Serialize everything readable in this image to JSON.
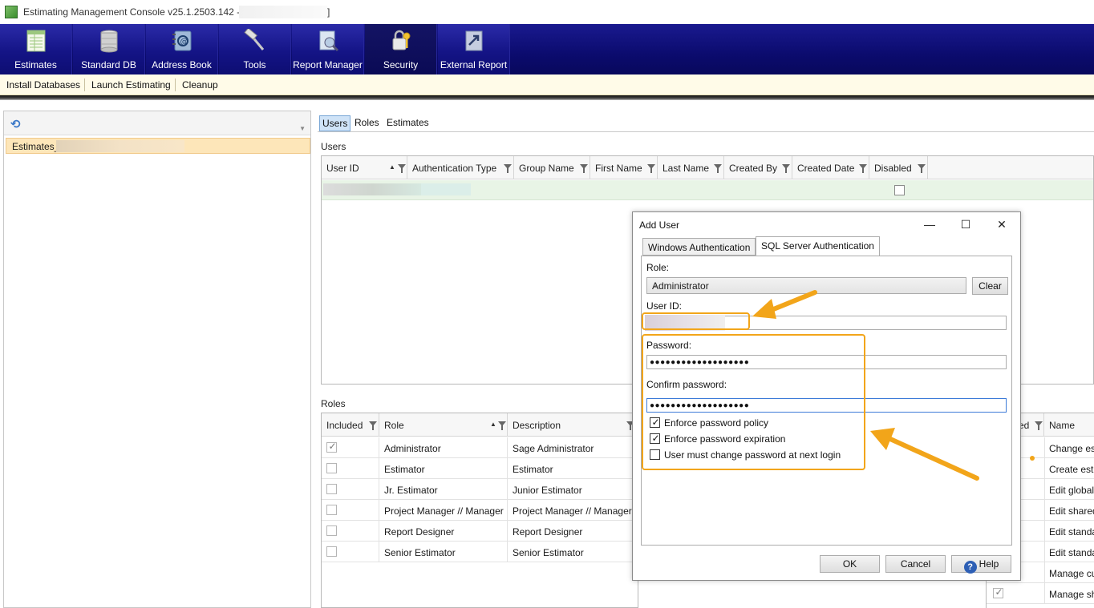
{
  "window": {
    "title": "Estimating Management Console v25.1.2503.142 - [",
    "title_end": "]"
  },
  "ribbon": {
    "items": [
      {
        "label": "Estimates",
        "icon": "estimates-icon"
      },
      {
        "label": "Standard DB",
        "icon": "database-icon"
      },
      {
        "label": "Address Book",
        "icon": "address-book-icon"
      },
      {
        "label": "Tools",
        "icon": "hammer-icon"
      },
      {
        "label": "Report Manager",
        "icon": "report-manager-icon"
      },
      {
        "label": "Security",
        "icon": "security-keys-icon"
      },
      {
        "label": "External Report",
        "icon": "external-report-icon"
      }
    ],
    "active": "Security"
  },
  "toolbar": {
    "install": "Install Databases",
    "launch": "Launch Estimating",
    "cleanup": "Cleanup"
  },
  "left_panel": {
    "db_prefix": "Estimates_"
  },
  "tabs": {
    "users": "Users",
    "roles": "Roles",
    "estimates": "Estimates"
  },
  "users": {
    "section": "Users",
    "columns": [
      "User ID",
      "Authentication Type",
      "Group Name",
      "First Name",
      "Last Name",
      "Created By",
      "Created Date",
      "Disabled"
    ]
  },
  "roles": {
    "section": "Roles",
    "columns": [
      "Included",
      "Role",
      "Description"
    ],
    "rows": [
      {
        "included": true,
        "role": "Administrator",
        "description": "Sage Administrator"
      },
      {
        "included": false,
        "role": "Estimator",
        "description": "Estimator"
      },
      {
        "included": false,
        "role": "Jr. Estimator",
        "description": "Junior Estimator"
      },
      {
        "included": false,
        "role": "Project Manager // Manager",
        "description": "Project Manager // Manager"
      },
      {
        "included": false,
        "role": "Report Designer",
        "description": "Report Designer"
      },
      {
        "included": false,
        "role": "Senior Estimator",
        "description": "Senior Estimator"
      }
    ]
  },
  "permissions": {
    "col_partial": "ed",
    "col_name": "Name",
    "rows": [
      "Change es",
      "Create esti",
      "Edit global",
      "Edit shared",
      "Edit standa",
      "Edit standa",
      "Manage cu",
      "Manage sh"
    ]
  },
  "dialog": {
    "title": "Add User",
    "tab_windows": "Windows Authentication",
    "tab_sql": "SQL Server Authentication",
    "role_label": "Role:",
    "role_value": "Administrator",
    "clear": "Clear",
    "userid_label": "User ID:",
    "password_label": "Password:",
    "password_mask": "●●●●●●●●●●●●●●●●●●●",
    "confirm_label": "Confirm password:",
    "confirm_mask": "●●●●●●●●●●●●●●●●●●●",
    "enforce_policy": "Enforce password policy",
    "enforce_expiration": "Enforce password expiration",
    "must_change": "User must change password at next login",
    "ok": "OK",
    "cancel": "Cancel",
    "help": "Help"
  },
  "colors": {
    "ribbon": "#0b0b6e",
    "highlight": "#f2a51a",
    "selected_row": "#fde6b9",
    "users_row": "#e8f4e6"
  }
}
